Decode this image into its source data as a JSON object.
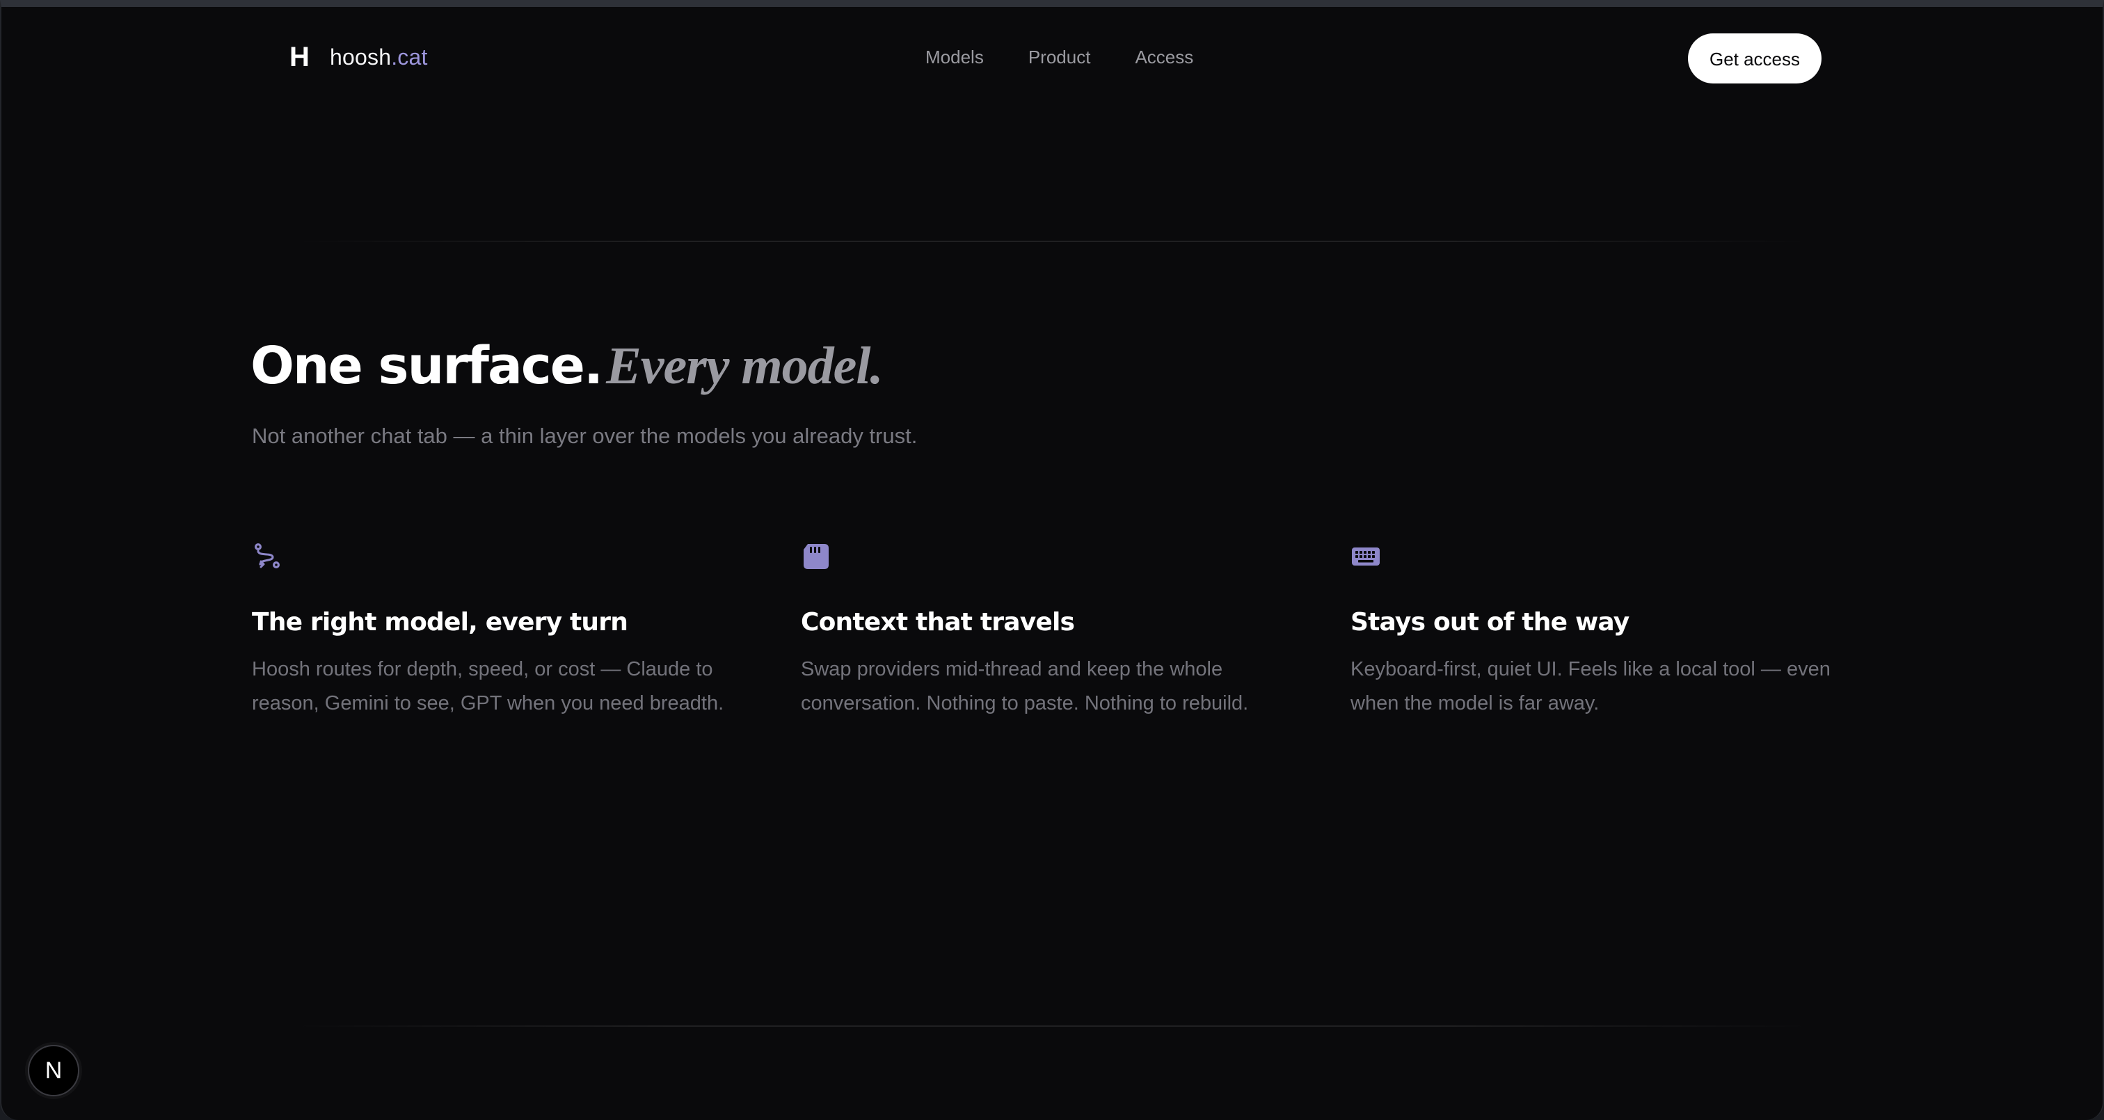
{
  "nav": {
    "logo_mark": "H",
    "brand_name": "hoosh",
    "brand_tld": ".cat",
    "links": [
      {
        "label": "Models"
      },
      {
        "label": "Product"
      },
      {
        "label": "Access"
      }
    ],
    "cta_label": "Get access"
  },
  "hero": {
    "title_strong": "One surface.",
    "title_italic": "Every model.",
    "subtitle": "Not another chat tab — a thin layer over the models you already trust."
  },
  "features": [
    {
      "icon": "route-icon",
      "title": "The right model, every turn",
      "description": "Hoosh routes for depth, speed, or cost — Claude to reason, Gemini to see, GPT when you need breadth."
    },
    {
      "icon": "memory-card-icon",
      "title": "Context that travels",
      "description": "Swap providers mid-thread and keep the whole conversation. Nothing to paste. Nothing to rebuild."
    },
    {
      "icon": "keyboard-icon",
      "title": "Stays out of the way",
      "description": "Keyboard-first, quiet UI. Feels like a local tool — even when the model is far away."
    }
  ],
  "dev_badge": {
    "label": "N",
    "icon": "nextjs-icon"
  },
  "colors": {
    "background": "#0a0a0c",
    "accent": "#9d96dc",
    "icon": "#8e87c9",
    "muted_text": "#73737b"
  }
}
